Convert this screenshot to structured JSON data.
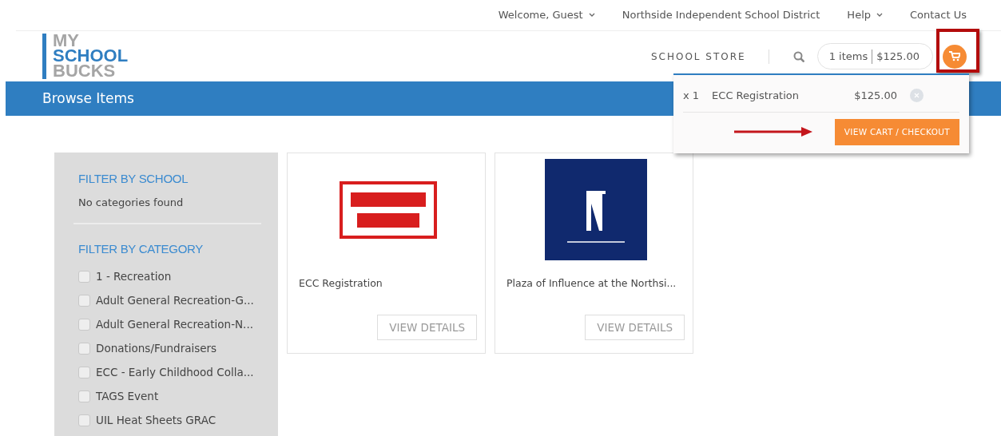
{
  "top_nav": [
    {
      "label": "Welcome, Guest",
      "dropdown": true
    },
    {
      "label": "Northside Independent School District",
      "dropdown": false
    },
    {
      "label": "Help",
      "dropdown": true
    },
    {
      "label": "Contact Us",
      "dropdown": false
    }
  ],
  "logo": {
    "lines": [
      "MY",
      "SCHOOL",
      "BUCKS"
    ]
  },
  "header": {
    "store_label": "SCHOOL STORE",
    "cart_count": "1 items",
    "cart_total": "$125.00"
  },
  "cart_dropdown": {
    "items": [
      {
        "qty": "x 1",
        "name": "ECC Registration",
        "price": "$125.00"
      }
    ],
    "checkout_button": "VIEW CART / CHECKOUT"
  },
  "page_title": "Browse Items",
  "filters": {
    "school_heading": "FILTER BY SCHOOL",
    "school_empty": "No categories found",
    "category_heading": "FILTER BY CATEGORY",
    "categories": [
      {
        "label": "1 - Recreation",
        "checked": false
      },
      {
        "label": "Adult General Recreation-G...",
        "checked": false
      },
      {
        "label": "Adult General Recreation-N...",
        "checked": false
      },
      {
        "label": "Donations/Fundraisers",
        "checked": false
      },
      {
        "label": "ECC - Early Childhood Colla...",
        "checked": false
      },
      {
        "label": "TAGS Event",
        "checked": false
      },
      {
        "label": "UIL Heat Sheets GRAC",
        "checked": false
      }
    ]
  },
  "products": [
    {
      "kind": "stamp",
      "name": "ECC Registration",
      "button": "VIEW DETAILS"
    },
    {
      "kind": "logo",
      "name": "Plaza of Influence at the Northsi...",
      "button": "VIEW DETAILS"
    }
  ]
}
